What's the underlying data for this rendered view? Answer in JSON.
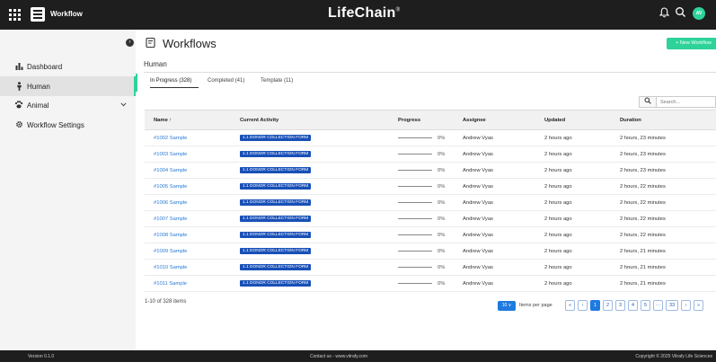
{
  "header": {
    "app_name": "Workflow",
    "brand": "LifeChain",
    "brand_mark": "®",
    "avatar_initials": "AV"
  },
  "sidebar": {
    "items": [
      {
        "label": "Dashboard",
        "icon": "chart-icon"
      },
      {
        "label": "Human",
        "icon": "person-icon"
      },
      {
        "label": "Animal",
        "icon": "paw-icon"
      },
      {
        "label": "Workflow Settings",
        "icon": "gear-icon"
      }
    ]
  },
  "main": {
    "title": "Workflows",
    "new_button": "+ New Workflow",
    "section": "Human",
    "tabs": [
      "In Progress (328)",
      "Completed (41)",
      "Template (11)"
    ],
    "search_placeholder": "Search..."
  },
  "table": {
    "headers": [
      "Name ↑",
      "Current Activity",
      "Progress",
      "Assignee",
      "Updated",
      "Duration"
    ],
    "rows": [
      {
        "name": "#1002 Sample",
        "activity": "1.1 DONOR COLLECTION FORM",
        "progress": "0%",
        "progress_value": 0,
        "assignee": "Andrew Vyas",
        "updated": "2 hours ago",
        "duration": "2 hours, 23 minutes"
      },
      {
        "name": "#1003 Sample",
        "activity": "1.1 DONOR COLLECTION FORM",
        "progress": "0%",
        "progress_value": 0,
        "assignee": "Andrew Vyas",
        "updated": "2 hours ago",
        "duration": "2 hours, 23 minutes"
      },
      {
        "name": "#1004 Sample",
        "activity": "1.1 DONOR COLLECTION FORM",
        "progress": "0%",
        "progress_value": 0,
        "assignee": "Andrew Vyas",
        "updated": "2 hours ago",
        "duration": "2 hours, 23 minutes"
      },
      {
        "name": "#1005 Sample",
        "activity": "1.1 DONOR COLLECTION FORM",
        "progress": "0%",
        "progress_value": 0,
        "assignee": "Andrew Vyas",
        "updated": "2 hours ago",
        "duration": "2 hours, 22 minutes"
      },
      {
        "name": "#1006 Sample",
        "activity": "1.1 DONOR COLLECTION FORM",
        "progress": "0%",
        "progress_value": 0,
        "assignee": "Andrew Vyas",
        "updated": "2 hours ago",
        "duration": "2 hours, 22 minutes"
      },
      {
        "name": "#1007 Sample",
        "activity": "1.1 DONOR COLLECTION FORM",
        "progress": "0%",
        "progress_value": 0,
        "assignee": "Andrew Vyas",
        "updated": "2 hours ago",
        "duration": "2 hours, 22 minutes"
      },
      {
        "name": "#1008 Sample",
        "activity": "1.1 DONOR COLLECTION FORM",
        "progress": "0%",
        "progress_value": 0,
        "assignee": "Andrew Vyas",
        "updated": "2 hours ago",
        "duration": "2 hours, 22 minutes"
      },
      {
        "name": "#1009 Sample",
        "activity": "1.1 DONOR COLLECTION FORM",
        "progress": "0%",
        "progress_value": 0,
        "assignee": "Andrew Vyas",
        "updated": "2 hours ago",
        "duration": "2 hours, 21 minutes"
      },
      {
        "name": "#1010 Sample",
        "activity": "1.1 DONOR COLLECTION FORM",
        "progress": "0%",
        "progress_value": 0,
        "assignee": "Andrew Vyas",
        "updated": "2 hours ago",
        "duration": "2 hours, 21 minutes"
      },
      {
        "name": "#1011 Sample",
        "activity": "1.1 DONOR COLLECTION FORM",
        "progress": "0%",
        "progress_value": 0,
        "assignee": "Andrew Vyas",
        "updated": "2 hours ago",
        "duration": "2 hours, 21 minutes"
      }
    ]
  },
  "pagination": {
    "summary": "1-10 of 328 items",
    "page_size": "10 ∨",
    "per_page_label": "Items per page",
    "first": "«",
    "prev": "‹",
    "pages": [
      "1",
      "2",
      "3",
      "4",
      "5",
      "···",
      "33"
    ],
    "active_page": "1",
    "next": "›",
    "last": "»"
  },
  "footer": {
    "version": "Version 0.1.0",
    "contact": "Contact us - www.vitrafy.com",
    "copyright": "Copyright © 2025 Vitrafy Life Sciences"
  },
  "colors": {
    "accent": "#2ed39a",
    "badge": "#1850b8",
    "link": "#2a7ad6",
    "topbar": "#1e1e1e"
  }
}
